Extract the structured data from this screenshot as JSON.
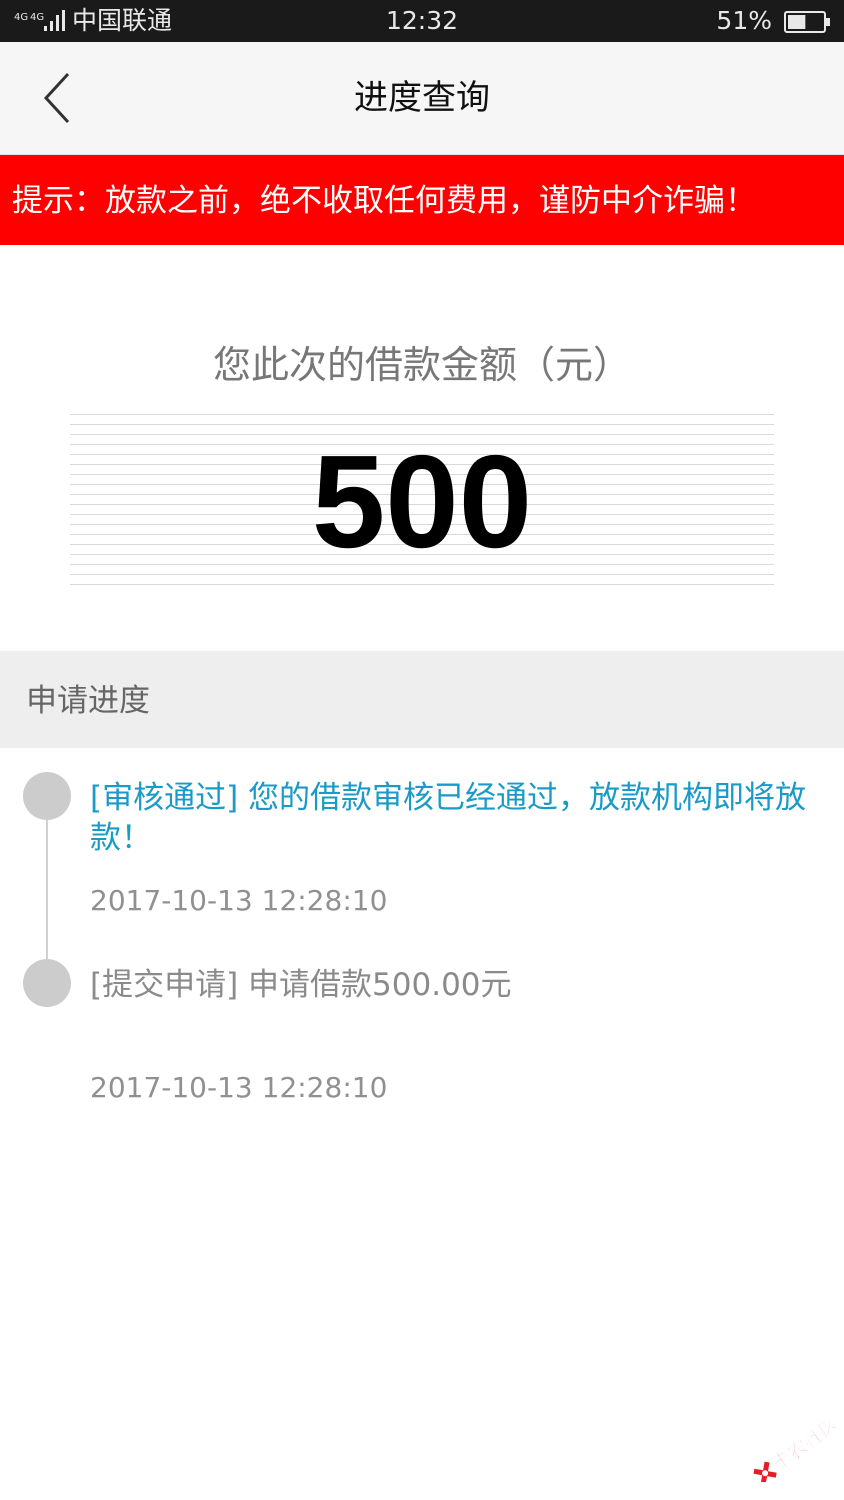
{
  "status_bar": {
    "network": "4G 4G",
    "carrier": "中国联通",
    "time": "12:32",
    "battery_percent": "51%",
    "battery_level": 0.51
  },
  "nav": {
    "title": "进度查询",
    "back_icon": "chevron-left-icon"
  },
  "banner": {
    "text": "提示：放款之前，绝不收取任何费用，谨防中介诈骗！",
    "color": "#ff0000"
  },
  "amount": {
    "label": "您此次的借款金额（元）",
    "value": "500"
  },
  "progress": {
    "section_label": "申请进度",
    "events": [
      {
        "text": "[审核通过] 您的借款审核已经通过，放款机构即将放款！",
        "time": "2017-10-13 12:28:10",
        "color": "#1a9bc7"
      },
      {
        "text": "[提交申请] 申请借款500.00元",
        "time": "2017-10-13 12:28:10",
        "color": "#8a8a8a"
      }
    ]
  },
  "watermark": {
    "text": "卡农社区"
  }
}
